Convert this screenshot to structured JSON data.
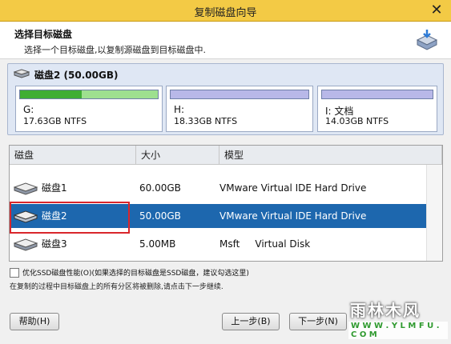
{
  "window": {
    "title": "复制磁盘向导",
    "close_glyph": "✕"
  },
  "header": {
    "title": "选择目标磁盘",
    "subtitle": "选择一个目标磁盘,以复制源磁盘到目标磁盘中.",
    "icon": "disk-copy-icon"
  },
  "disk_panel": {
    "title": "磁盘2 (50.00GB)",
    "partitions": [
      {
        "label": "G:",
        "info": "17.63GB NTFS",
        "used_fraction": 0.45,
        "color_used": "#3fae34",
        "color_free": "#9ee08f"
      },
      {
        "label": "H:",
        "info": "18.33GB NTFS",
        "used_fraction": 0.0,
        "color_used": "#b8b8e8",
        "color_free": "#b8b8e8"
      },
      {
        "label": "I: 文档",
        "info": "14.03GB NTFS",
        "used_fraction": 0.0,
        "color_used": "#b8b8e8",
        "color_free": "#b8b8e8"
      }
    ]
  },
  "table": {
    "columns": [
      "磁盘",
      "大小",
      "模型"
    ],
    "rows": [
      {
        "disk": "磁盘1",
        "size": "60.00GB",
        "model": "VMware Virtual IDE Hard Drive",
        "selected": false
      },
      {
        "disk": "磁盘2",
        "size": "50.00GB",
        "model": "VMware Virtual IDE Hard Drive",
        "selected": true
      },
      {
        "disk": "磁盘3",
        "size": "5.00MB",
        "model": "Msft     Virtual Disk",
        "selected": false
      }
    ]
  },
  "options": {
    "ssd_optimize_label": "优化SSD磁盘性能(O)(如果选择的目标磁盘是SSD磁盘，建议勾选这里)",
    "ssd_optimize_checked": false,
    "note": "在复制的过程中目标磁盘上的所有分区将被删除,请点击下一步继续."
  },
  "buttons": {
    "help": "帮助(H)",
    "back": "上一步(B)",
    "next": "下一步(N)"
  },
  "watermark": {
    "text": "雨林木风",
    "url": "W W W . Y L M F U . C O M"
  }
}
